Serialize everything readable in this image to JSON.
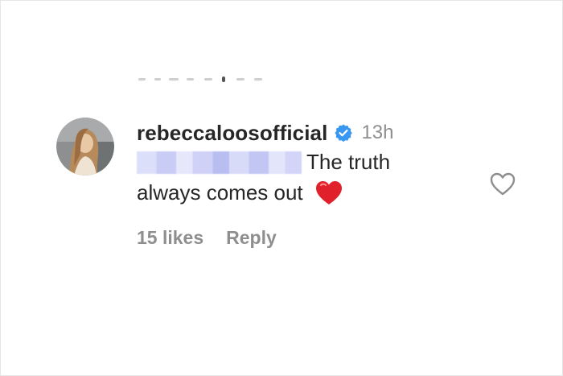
{
  "comment": {
    "username": "rebeccaloosofficial",
    "verified_icon": "verified-badge-icon",
    "time_ago": "13h",
    "text_line1": "The truth",
    "text_line2": "always comes out",
    "emoji": "red-heart-emoji",
    "likes": "15 likes",
    "reply": "Reply"
  },
  "colors": {
    "text": "#262626",
    "muted": "#8e8e8e",
    "verified": "#3897f0",
    "heart": "#e0212b"
  }
}
